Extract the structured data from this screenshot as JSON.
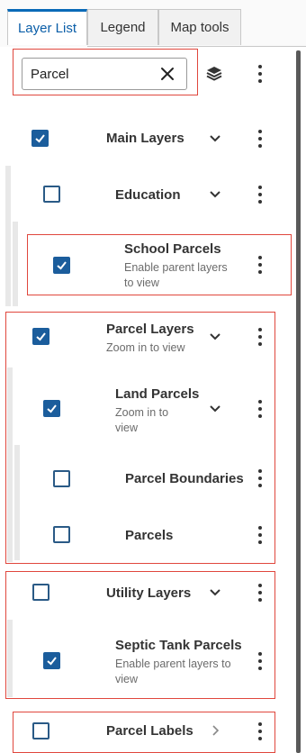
{
  "tabs": [
    {
      "label": "Layer List",
      "active": true
    },
    {
      "label": "Legend",
      "active": false
    },
    {
      "label": "Map tools",
      "active": false
    }
  ],
  "search": {
    "value": "Parcel",
    "placeholder": ""
  },
  "layers": {
    "main": {
      "label": "Main Layers",
      "checked": true
    },
    "education": {
      "label": "Education",
      "checked": false
    },
    "school": {
      "label": "School Parcels",
      "sub1": "Enable parent layers",
      "sub2": "to view",
      "checked": true
    },
    "parcel_layers": {
      "label": "Parcel Layers",
      "sub1": "Zoom in to view",
      "checked": true
    },
    "land": {
      "label": "Land Parcels",
      "sub1": "Zoom in to",
      "sub2": "view",
      "checked": true
    },
    "boundaries": {
      "label": "Parcel Boundaries",
      "checked": false
    },
    "parcels": {
      "label": "Parcels",
      "checked": false
    },
    "utility": {
      "label": "Utility Layers",
      "checked": false
    },
    "septic": {
      "label": "Septic Tank Parcels",
      "sub1": "Enable parent layers to",
      "sub2": "view",
      "checked": true
    },
    "labels": {
      "label": "Parcel Labels",
      "checked": false
    }
  },
  "colors": {
    "accent": "#1b5d9c",
    "highlight": "#e0473d",
    "tab_active": "#0a5ea8"
  }
}
